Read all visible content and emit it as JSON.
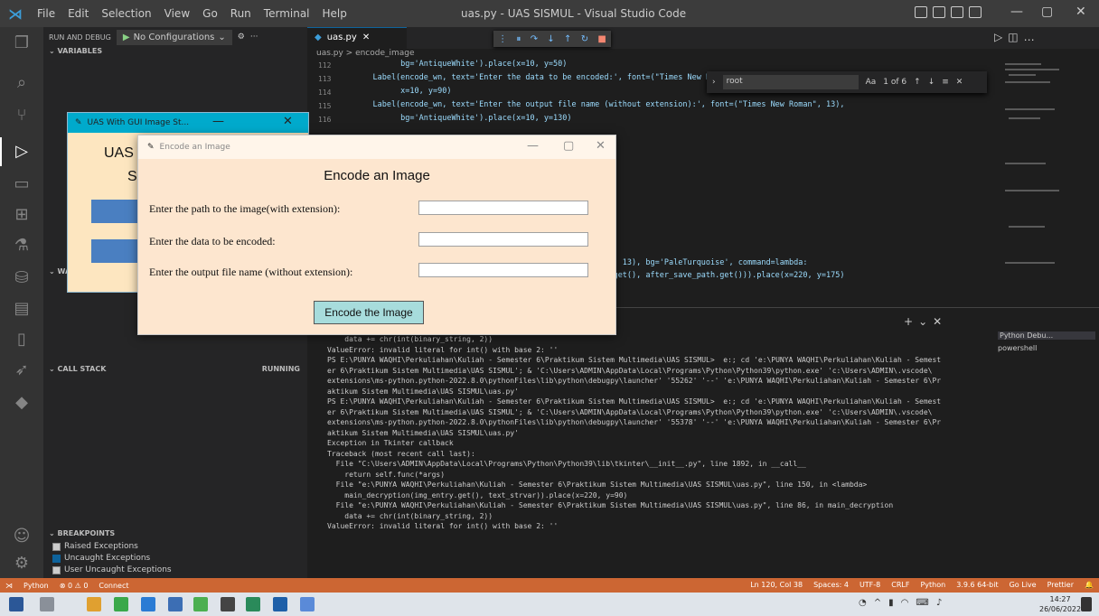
{
  "titlebar": {
    "menu": [
      "File",
      "Edit",
      "Selection",
      "View",
      "Go",
      "Run",
      "Terminal",
      "Help"
    ],
    "window_title": "uas.py - UAS SISMUL - Visual Studio Code",
    "min": "—",
    "max": "▢",
    "close": "✕"
  },
  "sidebar": {
    "run_label": "RUN AND DEBUG",
    "config": "No Configurations",
    "sections": {
      "variables": "VARIABLES",
      "watch": "WATCH",
      "call_stack": "CALL STACK",
      "call_stack_status": "RUNNING",
      "breakpoints": "BREAKPOINTS"
    },
    "breakpoints": [
      "Raised Exceptions",
      "Uncaught Exceptions",
      "User Uncaught Exceptions"
    ]
  },
  "editor": {
    "tab": "uas.py",
    "breadcrumb": "uas.py > encode_image",
    "find_value": "root",
    "find_count": "1 of 6",
    "lines": [
      {
        "num": "112",
        "code": "          bg='AntiqueWhite').place(x=10, y=50)"
      },
      {
        "num": "113",
        "code": "    Label(encode_wn, text='Enter the data to be encoded:', font=(\"Times New Roman\", 13),"
      },
      {
        "num": "114",
        "code": "          x=10, y=90)"
      },
      {
        "num": "115",
        "code": "    Label(encode_wn, text='Enter the output file name (without extension):', font=(\"Times New Roman\", 13),"
      },
      {
        "num": "116",
        "code": "          bg='AntiqueWhite').place(x=10, y=130)"
      },
      {
        "num": "",
        "code": "                                            ('Helvetica', 13), bg='PaleTurquoise', command=lambda:"
      },
      {
        "num": "",
        "code": "                                            _to_encoded.get(), after_save_path.get())).place(x=220, y=175)"
      }
    ]
  },
  "terminal": {
    "list": [
      "Python Debu...",
      "powershell"
    ],
    "lines": [
      "    data += chr(int(binary_string, 2))",
      "ValueError: invalid literal for int() with base 2: ''",
      "PS E:\\PUNYA WAQHI\\Perkuliahan\\Kuliah - Semester 6\\Praktikum Sistem Multimedia\\UAS SISMUL>  e:; cd 'e:\\PUNYA WAQHI\\Perkuliahan\\Kuliah - Semest",
      "er 6\\Praktikum Sistem Multimedia\\UAS SISMUL'; & 'C:\\Users\\ADMIN\\AppData\\Local\\Programs\\Python\\Python39\\python.exe' 'c:\\Users\\ADMIN\\.vscode\\",
      "extensions\\ms-python.python-2022.8.0\\pythonFiles\\lib\\python\\debugpy\\launcher' '55262' '--' 'e:\\PUNYA WAQHI\\Perkuliahan\\Kuliah - Semester 6\\Pr",
      "aktikum Sistem Multimedia\\UAS SISMUL\\uas.py'",
      "PS E:\\PUNYA WAQHI\\Perkuliahan\\Kuliah - Semester 6\\Praktikum Sistem Multimedia\\UAS SISMUL>  e:; cd 'e:\\PUNYA WAQHI\\Perkuliahan\\Kuliah - Semest",
      "er 6\\Praktikum Sistem Multimedia\\UAS SISMUL'; & 'C:\\Users\\ADMIN\\AppData\\Local\\Programs\\Python\\Python39\\python.exe' 'c:\\Users\\ADMIN\\.vscode\\",
      "extensions\\ms-python.python-2022.8.0\\pythonFiles\\lib\\python\\debugpy\\launcher' '55378' '--' 'e:\\PUNYA WAQHI\\Perkuliahan\\Kuliah - Semester 6\\Pr",
      "aktikum Sistem Multimedia\\UAS SISMUL\\uas.py'",
      "Exception in Tkinter callback",
      "Traceback (most recent call last):",
      "  File \"C:\\Users\\ADMIN\\AppData\\Local\\Programs\\Python\\Python39\\lib\\tkinter\\__init__.py\", line 1892, in __call__",
      "    return self.func(*args)",
      "  File \"e:\\PUNYA WAQHI\\Perkuliahan\\Kuliah - Semester 6\\Praktikum Sistem Multimedia\\UAS SISMUL\\uas.py\", line 150, in <lambda>",
      "    main_decryption(img_entry.get(), text_strvar)).place(x=220, y=90)",
      "  File \"e:\\PUNYA WAQHI\\Perkuliahan\\Kuliah - Semester 6\\Praktikum Sistem Multimedia\\UAS SISMUL\\uas.py\", line 86, in main_decryption",
      "    data += chr(int(binary_string, 2))",
      "ValueError: invalid literal for int() with base 2: ''"
    ]
  },
  "statusbar": {
    "left": [
      "Python",
      "⊗ 0 ⚠ 0",
      "Connect"
    ],
    "right": [
      "Ln 120, Col 38",
      "Spaces: 4",
      "UTF-8",
      "CRLF",
      "Python",
      "3.9.6 64-bit",
      "Go Live",
      "Prettier"
    ]
  },
  "taskbar": {
    "time": "14:27",
    "date": "26/06/2022"
  },
  "main_window": {
    "title": "UAS With GUI Image St...",
    "heading_line1": "UAS",
    "heading_line2": "S"
  },
  "encode_window": {
    "title": "Encode an Image",
    "heading": "Encode an Image",
    "label_path": "Enter the path to the image(with extension):",
    "label_data": "Enter the data to be encoded:",
    "label_output": "Enter the output file name (without extension):",
    "button": "Encode the Image",
    "min": "—",
    "max": "▢",
    "close": "✕"
  },
  "colors": {
    "encode_window_bg": "#fde6cf",
    "button_bg": "#a7dcdc",
    "statusbar_bg": "#cc6633",
    "main_window_titlebar": "#00aacc"
  }
}
